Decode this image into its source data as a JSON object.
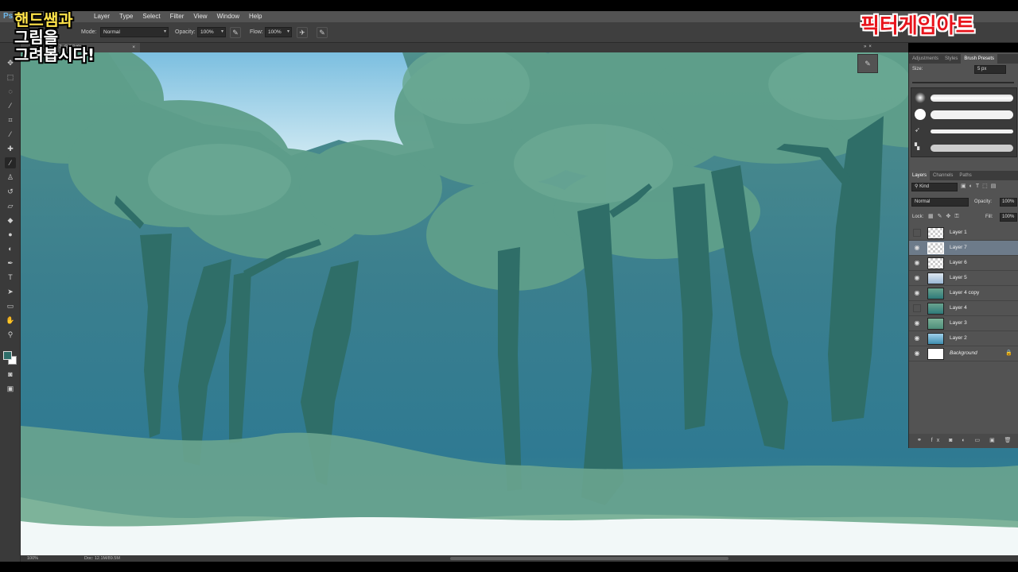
{
  "app": {
    "logo": "Ps",
    "menu": [
      "Layer",
      "Type",
      "Select",
      "Filter",
      "View",
      "Window",
      "Help"
    ]
  },
  "options": {
    "mode_label": "Mode:",
    "mode_value": "Normal",
    "opacity_label": "Opacity:",
    "opacity_value": "100%",
    "flow_label": "Flow:",
    "flow_value": "100%"
  },
  "document": {
    "tab_title": "% (Layer 7, RGB/8) *",
    "tab_close": "×"
  },
  "status": {
    "zoom": "100%",
    "doc": "Doc: 12.1M/89.5M"
  },
  "brush_panel": {
    "tabs": [
      "Adjustments",
      "Styles",
      "Brush Presets"
    ],
    "size_label": "Size:",
    "size_value": "5 px"
  },
  "layers_panel": {
    "tabs": [
      "Layers",
      "Channels",
      "Paths"
    ],
    "kind_label": "Kind",
    "blend_mode": "Normal",
    "opacity_label": "Opacity:",
    "opacity_value": "100%",
    "lock_label": "Lock:",
    "fill_label": "Fill:",
    "fill_value": "100%",
    "layers": [
      {
        "name": "Layer 1",
        "visible": false,
        "selected": false,
        "thumb": "checker"
      },
      {
        "name": "Layer 7",
        "visible": true,
        "selected": true,
        "thumb": "checker"
      },
      {
        "name": "Layer 6",
        "visible": true,
        "selected": false,
        "thumb": "checker"
      },
      {
        "name": "Layer 5",
        "visible": true,
        "selected": false,
        "thumb": "blue"
      },
      {
        "name": "Layer 4 copy",
        "visible": true,
        "selected": false,
        "thumb": "teal"
      },
      {
        "name": "Layer 4",
        "visible": false,
        "selected": false,
        "thumb": "teal"
      },
      {
        "name": "Layer 3",
        "visible": true,
        "selected": false,
        "thumb": "green"
      },
      {
        "name": "Layer 2",
        "visible": true,
        "selected": false,
        "thumb": "sky"
      },
      {
        "name": "Background",
        "visible": true,
        "selected": false,
        "thumb": "white",
        "locked": true
      }
    ]
  },
  "overlay": {
    "left_line1": "핸드쌤과",
    "left_line2": "그림을",
    "left_line3": "그려봅시다!",
    "right_title": "픽터게임아트"
  },
  "colors": {
    "foreground": "#2f6e6a",
    "background": "#ffffff",
    "accent_red": "#e8141c"
  }
}
